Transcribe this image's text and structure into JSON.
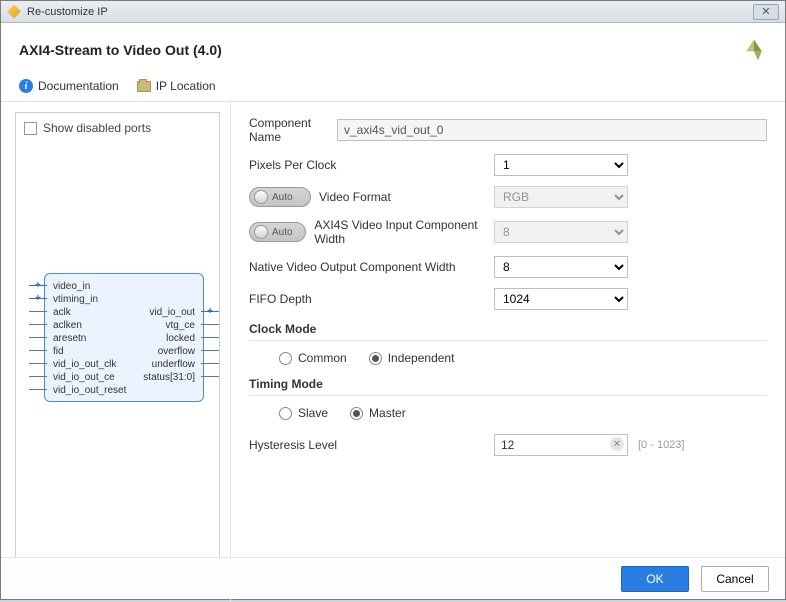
{
  "window": {
    "title": "Re-customize IP"
  },
  "header": {
    "ip_title": "AXI4-Stream to Video Out (4.0)"
  },
  "toolbar": {
    "doc_label": "Documentation",
    "iploc_label": "IP Location"
  },
  "left": {
    "show_disabled_label": "Show disabled ports",
    "ports_left": [
      "video_in",
      "vtiming_in",
      "aclk",
      "aclken",
      "aresetn",
      "fid",
      "vid_io_out_clk",
      "vid_io_out_ce",
      "vid_io_out_reset"
    ],
    "ports_right": [
      "vid_io_out",
      "vtg_ce",
      "locked",
      "overflow",
      "underflow",
      "status[31:0]"
    ]
  },
  "form": {
    "component_name_label": "Component Name",
    "component_name_value": "v_axi4s_vid_out_0",
    "pixels_label": "Pixels Per Clock",
    "pixels_value": "1",
    "video_format_label": "Video Format",
    "video_format_value": "RGB",
    "axi4s_width_label": "AXI4S Video Input Component Width",
    "axi4s_width_value": "8",
    "native_width_label": "Native Video Output Component Width",
    "native_width_value": "8",
    "fifo_label": "FIFO Depth",
    "fifo_value": "1024",
    "auto_label": "Auto",
    "clock_mode_head": "Clock Mode",
    "clock_common": "Common",
    "clock_independent": "Independent",
    "timing_mode_head": "Timing Mode",
    "timing_slave": "Slave",
    "timing_master": "Master",
    "hysteresis_label": "Hysteresis Level",
    "hysteresis_value": "12",
    "hysteresis_hint": "[0 - 1023]"
  },
  "footer": {
    "ok": "OK",
    "cancel": "Cancel"
  }
}
